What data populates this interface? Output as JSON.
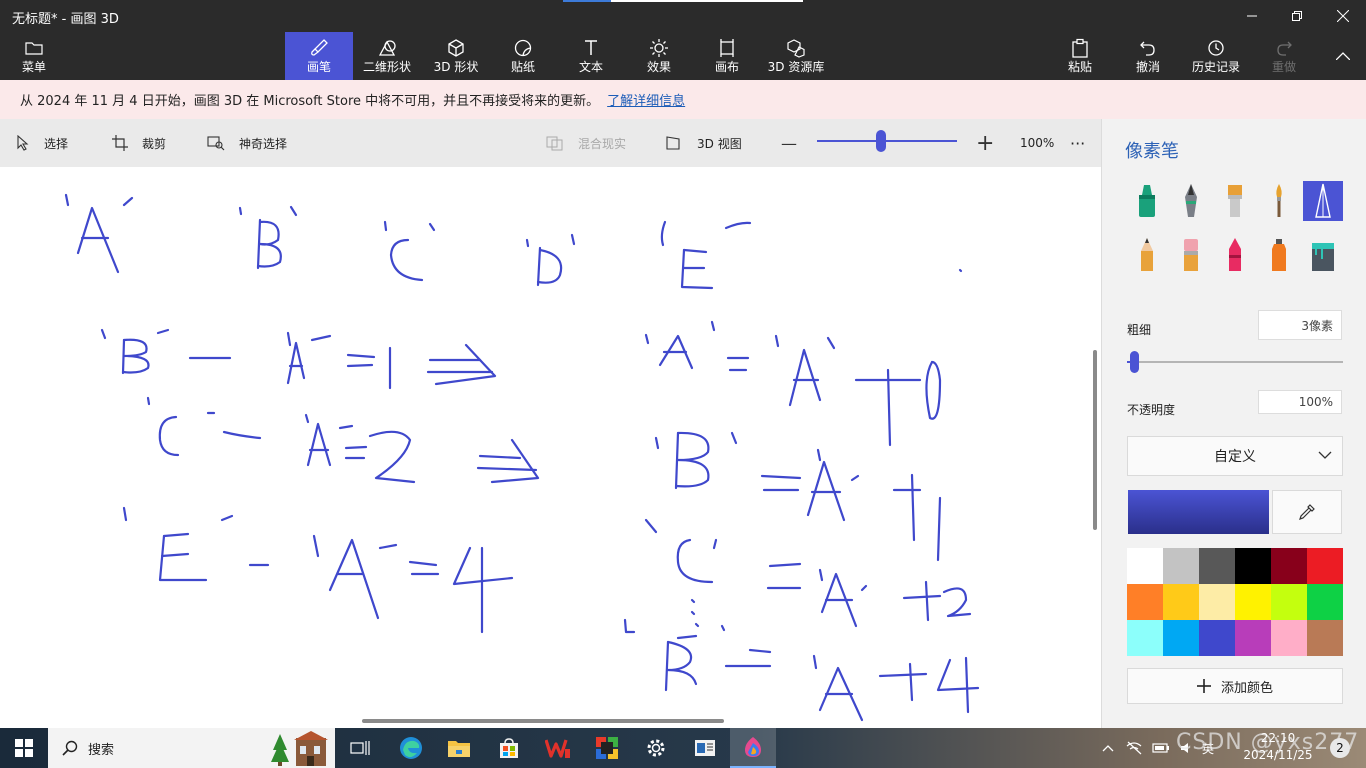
{
  "window": {
    "title": "无标题* - 画图 3D"
  },
  "ribbon": {
    "menu_label": "菜单",
    "tabs": [
      {
        "label": "画笔",
        "icon": "brush-icon",
        "active": true
      },
      {
        "label": "二维形状",
        "icon": "2d-shapes-icon"
      },
      {
        "label": "3D 形状",
        "icon": "3d-cube-icon"
      },
      {
        "label": "贴纸",
        "icon": "sticker-icon"
      },
      {
        "label": "文本",
        "icon": "text-icon"
      },
      {
        "label": "效果",
        "icon": "sun-effects-icon"
      },
      {
        "label": "画布",
        "icon": "canvas-icon"
      },
      {
        "label": "3D 资源库",
        "icon": "3d-library-icon"
      }
    ],
    "right": {
      "paste": "粘贴",
      "undo": "撤消",
      "history": "历史记录",
      "redo": "重做"
    }
  },
  "notice": {
    "text": "从 2024 年 11 月 4 日开始，画图 3D 在 Microsoft Store 中将不可用，并且不再接受将来的更新。",
    "link": "了解详细信息"
  },
  "toolbar": {
    "select": "选择",
    "crop": "裁剪",
    "magic_select": "神奇选择",
    "mixed_reality": "混合现实",
    "view_3d": "3D 视图",
    "zoom_minus": "—",
    "zoom_plus": "+",
    "zoom_value": "100%",
    "zoom_level": 0.46,
    "more": "···"
  },
  "panel": {
    "title": "像素笔",
    "thickness_label": "粗细",
    "thickness_value": "3像素",
    "opacity_label": "不透明度",
    "opacity_value": "100%",
    "preset": "自定义",
    "add_color": "添加颜色",
    "current_color": "#4b54d4",
    "palette": [
      "#ffffff",
      "#c3c3c3",
      "#585858",
      "#000000",
      "#88001b",
      "#ec1c24",
      "#ff7f27",
      "#ffca18",
      "#fdeca6",
      "#fff200",
      "#c4ff0e",
      "#0ed145",
      "#8cfffb",
      "#00a8f3",
      "#3f48cc",
      "#b83dba",
      "#ffaec8",
      "#b97a56"
    ]
  },
  "taskbar": {
    "search_label": "搜索",
    "clock_time": "22:10",
    "clock_date": "2024/11/25",
    "ime": "英",
    "notifications": "2",
    "watermark": "CSDN @yxs277"
  }
}
